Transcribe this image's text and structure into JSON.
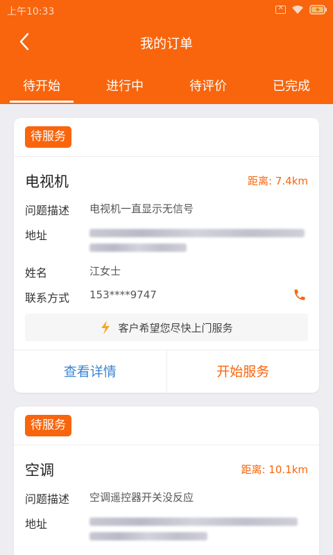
{
  "status_bar": {
    "time": "上午10:33"
  },
  "nav": {
    "title": "我的订单"
  },
  "tabs": [
    {
      "label": "待开始",
      "active": true
    },
    {
      "label": "进行中",
      "active": false
    },
    {
      "label": "待评价",
      "active": false
    },
    {
      "label": "已完成",
      "active": false
    }
  ],
  "colors": {
    "brand": "#f8650d",
    "link": "#3a86d3"
  },
  "orders": [
    {
      "status": "待服务",
      "item": "电视机",
      "distance": "距离: 7.4km",
      "desc_label": "问题描述",
      "desc": "电视机一直显示无信号",
      "address_label": "地址",
      "name_label": "姓名",
      "name": "江女士",
      "contact_label": "联系方式",
      "phone": "153****9747",
      "hint": "客户希望您尽快上门服务",
      "detail_btn": "查看详情",
      "start_btn": "开始服务"
    },
    {
      "status": "待服务",
      "item": "空调",
      "distance": "距离: 10.1km",
      "desc_label": "问题描述",
      "desc": "空调遥控器开关没反应",
      "address_label": "地址"
    }
  ]
}
